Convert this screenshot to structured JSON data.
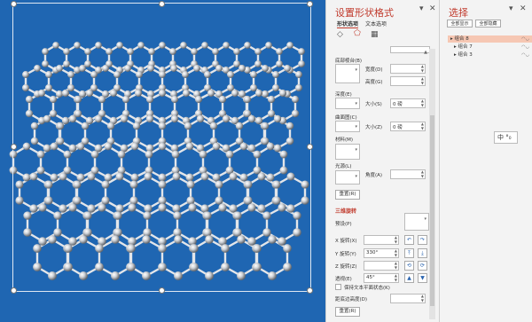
{
  "format_pane": {
    "title": "设置形状格式",
    "tabs": [
      "形状选项",
      "文本选项"
    ],
    "bevel_bottom_label": "底部棱台(B)",
    "width_label": "宽度(D)",
    "height_label": "高度(G)",
    "depth_label": "深度(E)",
    "size_label_1": "大小(S)",
    "depth_value": "0 磅",
    "contour_label": "曲面图(C)",
    "size_label_2": "大小(Z)",
    "contour_value": "0 磅",
    "material_label": "材料(M)",
    "lighting_label": "光源(L)",
    "angle_label": "角度(A)",
    "reset_button": "重置(R)",
    "rotation_section": "三维旋转",
    "preset_label": "预设(P)",
    "x_rotation_label": "X 旋转(X)",
    "x_rotation_value": "",
    "y_rotation_label": "Y 旋转(Y)",
    "y_rotation_value": "330°",
    "z_rotation_label": "Z 旋转(Z)",
    "z_rotation_value": "",
    "perspective_label": "透视(E)",
    "perspective_value": "45°",
    "keep_text_flat_label": "保持文本平面状态(K)",
    "distance_label": "距底边高度(D)",
    "reset_button_2": "重置(R)",
    "pin_icon": "pin-icon",
    "close_icon": "close-icon"
  },
  "selection_pane": {
    "title": "选择",
    "show_all": "全部显示",
    "hide_all": "全部隐藏",
    "items": [
      {
        "label": "组合 8",
        "selected": true
      },
      {
        "label": "组合 7",
        "selected": false
      },
      {
        "label": "组合 3",
        "selected": false
      }
    ]
  },
  "ime_indicator": "中 °₀",
  "colors": {
    "slide_background": "#1f66b2",
    "accent": "#c0392b",
    "selection_highlight": "#f6c7b3"
  }
}
